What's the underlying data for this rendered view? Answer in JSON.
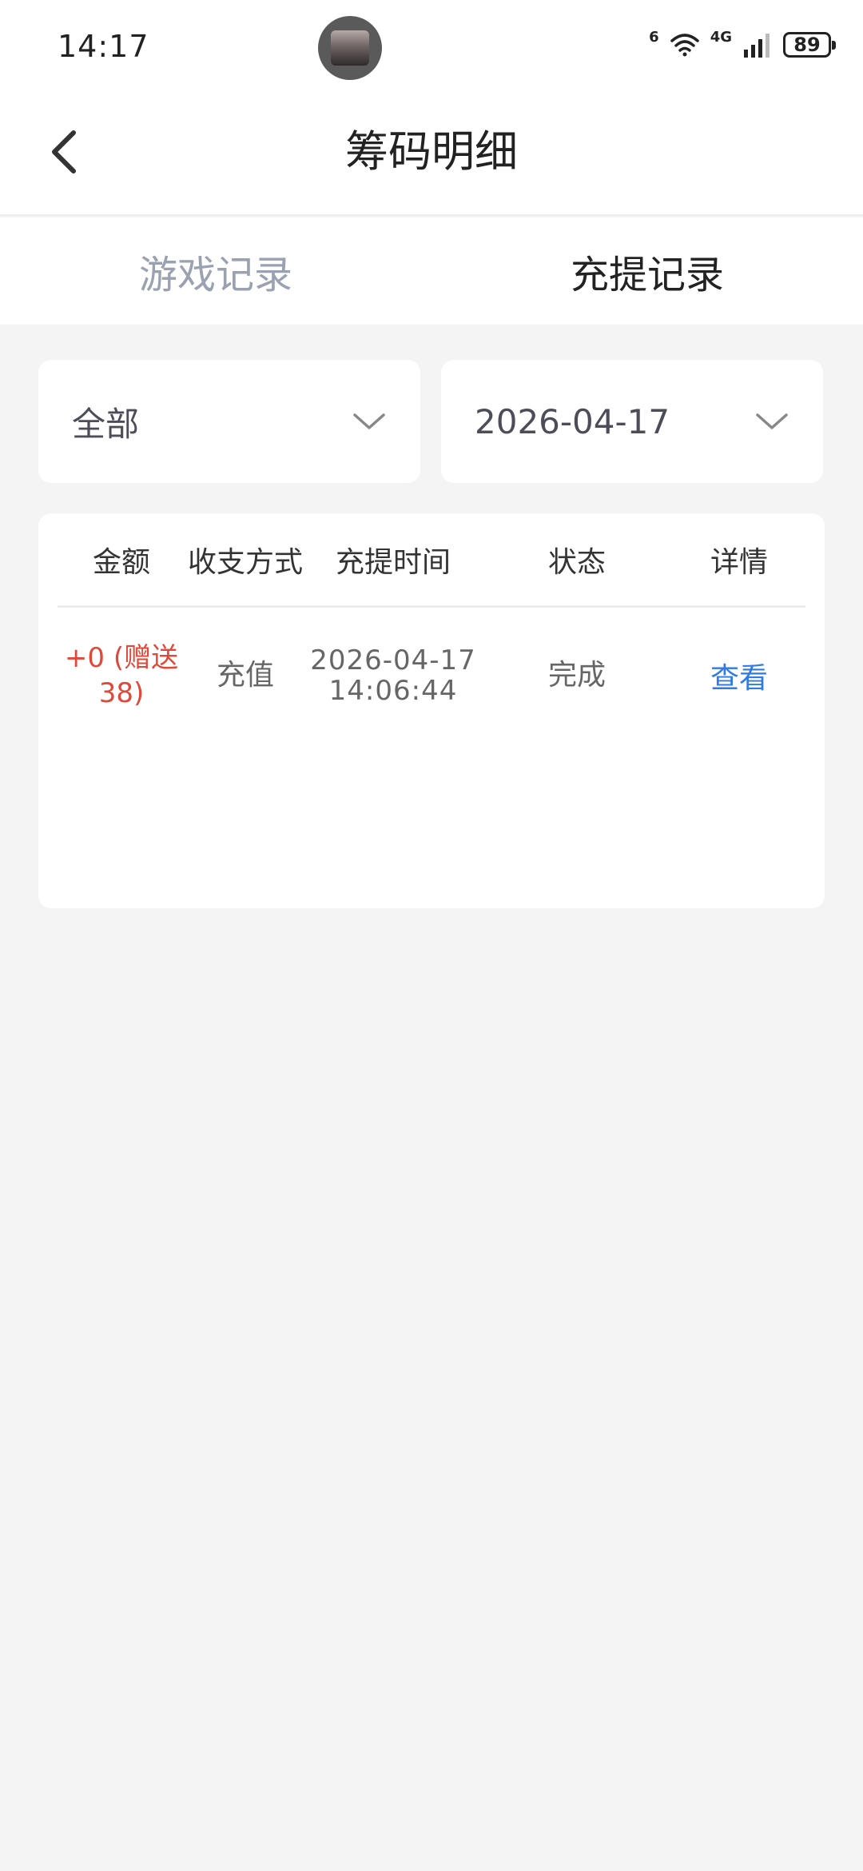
{
  "status_bar": {
    "time": "14:17",
    "wifi_label": "6",
    "network_label": "4G",
    "battery": "89"
  },
  "header": {
    "title": "筹码明细"
  },
  "tabs": [
    {
      "label": "游戏记录",
      "active": false
    },
    {
      "label": "充提记录",
      "active": true
    }
  ],
  "filters": {
    "type": "全部",
    "date": "2026-04-17"
  },
  "table": {
    "columns": [
      "金额",
      "收支方式",
      "充提时间",
      "状态",
      "详情"
    ],
    "rows": [
      {
        "amount": "+0 (赠送38)",
        "method": "充值",
        "date": "2026-04-17",
        "time": "14:06:44",
        "status": "完成",
        "detail": "查看"
      }
    ]
  },
  "colors": {
    "accent_link": "#2f7ae5",
    "amount_red": "#e0483a",
    "background": "#f4f4f4"
  }
}
